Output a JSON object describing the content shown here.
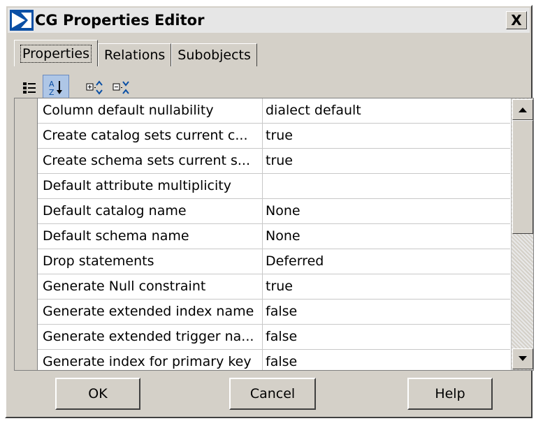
{
  "window": {
    "title": "CG Properties Editor",
    "close_label": "X"
  },
  "tabs": [
    {
      "label": "Properties",
      "active": true
    },
    {
      "label": "Relations",
      "active": false
    },
    {
      "label": "Subobjects",
      "active": false
    }
  ],
  "toolbar": {
    "icons": [
      "categorized-view-icon",
      "sort-alphabetically-icon",
      "expand-all-icon",
      "collapse-all-icon"
    ]
  },
  "properties": [
    {
      "name": "Column default nullability",
      "value": "dialect default"
    },
    {
      "name": "Create catalog sets current c...",
      "value": "true"
    },
    {
      "name": "Create schema sets current s...",
      "value": "true"
    },
    {
      "name": "Default attribute multiplicity",
      "value": ""
    },
    {
      "name": "Default catalog name",
      "value": "None"
    },
    {
      "name": "Default schema name",
      "value": "None"
    },
    {
      "name": "Drop statements",
      "value": "Deferred"
    },
    {
      "name": "Generate Null constraint",
      "value": "true"
    },
    {
      "name": "Generate extended index name",
      "value": "false"
    },
    {
      "name": "Generate extended trigger na...",
      "value": "false"
    },
    {
      "name": "Generate index for primary key",
      "value": "false"
    }
  ],
  "buttons": {
    "ok": "OK",
    "cancel": "Cancel",
    "help": "Help"
  },
  "colors": {
    "dialog_bg": "#d4d0c8",
    "pressed_toolbar_bg": "#aec6e6",
    "icon_blue": "#0a4fa5"
  }
}
